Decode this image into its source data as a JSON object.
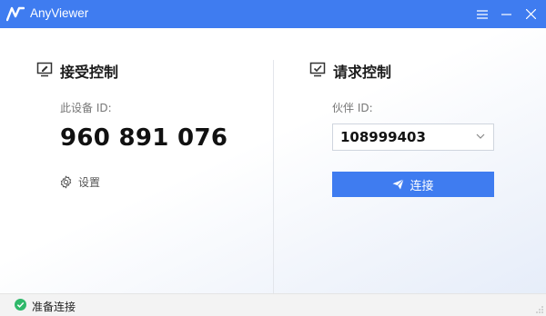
{
  "app": {
    "title": "AnyViewer"
  },
  "window_controls": {
    "menu_icon": "hamburger-menu-icon",
    "minimize_icon": "minimize-icon",
    "close_icon": "close-icon"
  },
  "colors": {
    "accent": "#3f7cf0",
    "success": "#2fb86a"
  },
  "receive": {
    "icon": "monitor-pen-icon",
    "title": "接受控制",
    "device_id_label": "此设备 ID:",
    "device_id": "960 891 076",
    "settings_icon": "gear-icon",
    "settings_label": "设置"
  },
  "request": {
    "icon": "monitor-check-icon",
    "title": "请求控制",
    "partner_id_label": "伙伴 ID:",
    "partner_id": "108999403",
    "dropdown_icon": "chevron-down-icon",
    "connect_icon": "send-icon",
    "connect_label": "连接"
  },
  "status": {
    "icon": "check-circle-icon",
    "text": "准备连接"
  }
}
